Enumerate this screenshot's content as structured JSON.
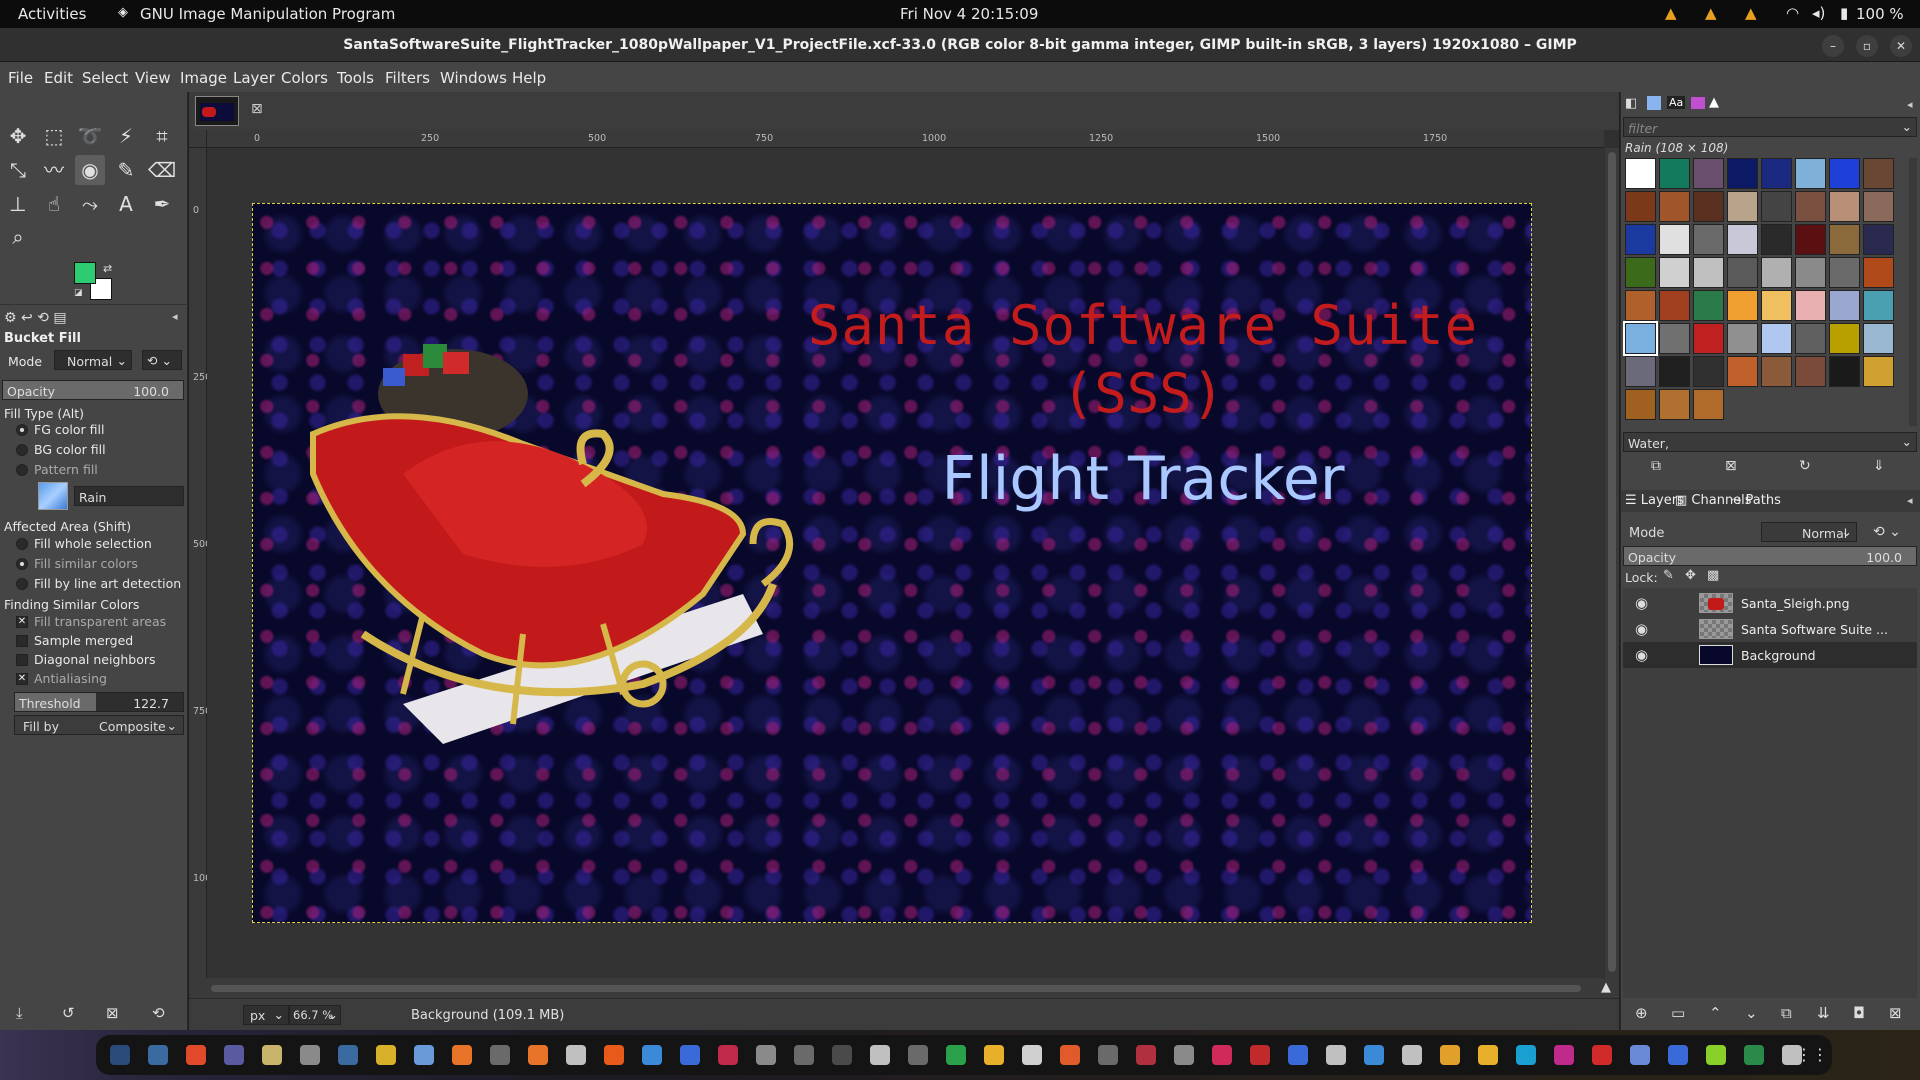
{
  "topbar": {
    "activities": "Activities",
    "app_name": "GNU Image Manipulation Program",
    "clock": "Fri Nov 4  20:15:09",
    "battery": "100 %"
  },
  "window": {
    "title": "SantaSoftwareSuite_FlightTracker_1080pWallpaper_V1_ProjectFile.xcf-33.0 (RGB color 8-bit gamma integer, GIMP built-in sRGB, 3 layers) 1920x1080 – GIMP"
  },
  "menubar": [
    "File",
    "Edit",
    "Select",
    "View",
    "Image",
    "Layer",
    "Colors",
    "Tools",
    "Filters",
    "Windows",
    "Help"
  ],
  "colors": {
    "foreground": "#2ecc71",
    "background": "#ffffff",
    "accent_selection": "#e6d23a",
    "title_red": "#c41c1c",
    "title_blue": "#a8c8ff"
  },
  "tool_options": {
    "title": "Bucket Fill",
    "mode_label": "Mode",
    "mode_value": "Normal",
    "opacity_label": "Opacity",
    "opacity_value": "100.0",
    "fill_type_label": "Fill Type  (Alt)",
    "fill_types": [
      "FG color fill",
      "BG color fill",
      "Pattern fill"
    ],
    "pattern_name": "Rain",
    "affected_area_label": "Affected Area  (Shift)",
    "affected_areas": [
      "Fill whole selection",
      "Fill similar colors",
      "Fill by line art detection"
    ],
    "finding_label": "Finding Similar Colors",
    "finding_options": [
      "Fill transparent areas",
      "Sample merged",
      "Diagonal neighbors",
      "Antialiasing"
    ],
    "threshold_label": "Threshold",
    "threshold_value": "122.7",
    "threshold_fraction": 0.48,
    "fill_by_label": "Fill by",
    "fill_by_value": "Composite"
  },
  "rulers": {
    "h_ticks": [
      "0",
      "250",
      "500",
      "750",
      "1000",
      "1250",
      "1500",
      "1750"
    ],
    "v_ticks": [
      "0",
      "250",
      "500",
      "750",
      "1000"
    ]
  },
  "canvas": {
    "line1": "Santa Software Suite",
    "line2": "(SSS)",
    "line3": "Flight Tracker"
  },
  "statusbar": {
    "unit": "px",
    "zoom": "66.7 %",
    "info": "Background (109.1 MB)"
  },
  "patterns": {
    "filter_placeholder": "filter",
    "current": "Rain (108 × 108)",
    "tag_value": "Water,",
    "swatch_colors": [
      "#ffffff",
      "#137a5e",
      "#6a4e6e",
      "#0c1a66",
      "#1b2a80",
      "#7fb0d8",
      "#1e3fd8",
      "#6a4634",
      "#7a3a1a",
      "#a0562a",
      "#5a3020",
      "#b8a48a",
      "#444444",
      "#7a5040",
      "#b89078",
      "#8a6a5a",
      "#1a3aa0",
      "#e0e0e0",
      "#6a6a6a",
      "#c8c8d8",
      "#2a2a2a",
      "#5a1010",
      "#8a6a3a",
      "#2a2a50",
      "#3a6a1a",
      "#d0d0d0",
      "#c0c0c0",
      "#5a5a5a",
      "#b0b0b0",
      "#8a8a8a",
      "#6a6a6a",
      "#b04a1a",
      "#b0602a",
      "#a04020",
      "#2a7a4a",
      "#f0a030",
      "#f0c060",
      "#e8b0b0",
      "#9aa8d0",
      "#4aa0b0",
      "#7ab0e0",
      "#707070",
      "#c02020",
      "#909090",
      "#b0c8f0",
      "#606060",
      "#b8a000",
      "#9ab8d0",
      "#6a6a7a",
      "#202020",
      "#303030",
      "#c0602a",
      "#8a5a3a",
      "#7a4a3a",
      "#1a1a1a",
      "#d0a030",
      "#a06020",
      "#b07030",
      "#b06a2a"
    ]
  },
  "layers": {
    "tabs": [
      "Layers",
      "Channels",
      "Paths"
    ],
    "mode_label": "Mode",
    "mode_value": "Normal",
    "opacity_label": "Opacity",
    "opacity_value": "100.0",
    "lock_label": "Lock:",
    "items": [
      {
        "name": "Santa_Sleigh.png"
      },
      {
        "name": "Santa Software Suite ..."
      },
      {
        "name": "Background"
      }
    ]
  },
  "taskbar_colors": [
    "#2a4a7a",
    "#3a6aa0",
    "#e04a2a",
    "#5a5aa0",
    "#c8b46a",
    "#8a8a8a",
    "#3a6aa0",
    "#d8b02a",
    "#6a9ad8",
    "#e8742a",
    "#6a6a6a",
    "#e8742a",
    "#c0c0c0",
    "#e85a1a",
    "#3a8ad8",
    "#3a6ad8",
    "#c02a4a",
    "#8a8a8a",
    "#6a6a6a",
    "#4a4a4a",
    "#c0c0c0",
    "#6a6a6a",
    "#2aa04a",
    "#e8b02a",
    "#d0d0d0",
    "#e05a2a",
    "#6a6a6a",
    "#b03040",
    "#8a8a8a",
    "#d02a5a",
    "#c02a2a",
    "#3a6ad8",
    "#c0c0c0",
    "#3a8ad8",
    "#c0c0c0",
    "#e0a02a",
    "#e8b02a",
    "#1aa0d0",
    "#c02a8a",
    "#d02a2a",
    "#6a8ad8",
    "#3a6ad8",
    "#8ad02a",
    "#2a8a4a",
    "#c0c0c0"
  ]
}
